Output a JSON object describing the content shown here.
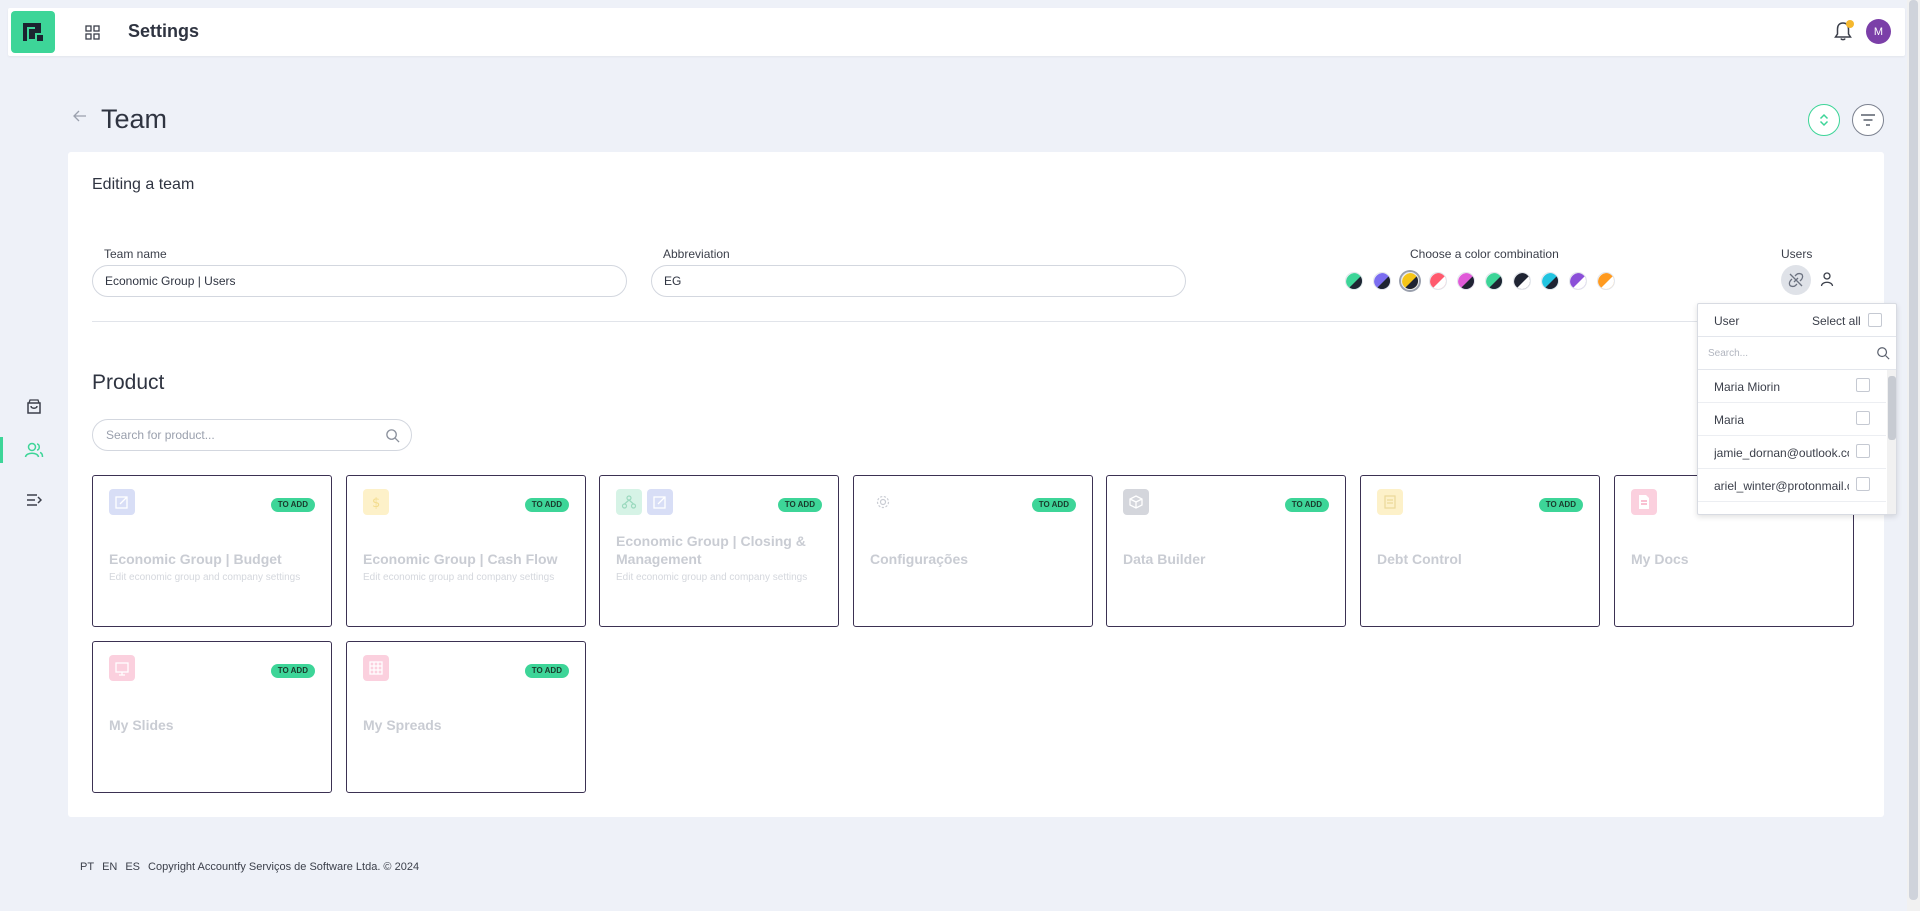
{
  "topbar": {
    "title": "Settings",
    "avatar_initial": "M"
  },
  "page": {
    "title": "Team"
  },
  "form": {
    "section_title": "Editing a team",
    "team_name_label": "Team name",
    "team_name_value": "Economic Group | Users",
    "abbreviation_label": "Abbreviation",
    "abbreviation_value": "EG",
    "color_label": "Choose a color combination",
    "users_label": "Users",
    "color_swatches": [
      {
        "c1": "#3dd598",
        "c2": "#1f2433"
      },
      {
        "c1": "#7b6df0",
        "c2": "#1f2433"
      },
      {
        "c1": "#f5c518",
        "c2": "#1f2433",
        "selected": true
      },
      {
        "c1": "#ff5a6e",
        "c2": "#ffffff"
      },
      {
        "c1": "#e05ad8",
        "c2": "#1f2433"
      },
      {
        "c1": "#3dd598",
        "c2": "#1f2433"
      },
      {
        "c1": "#1f2433",
        "c2": "#ffffff"
      },
      {
        "c1": "#22c4e0",
        "c2": "#1f2433"
      },
      {
        "c1": "#8b4fd8",
        "c2": "#ffffff"
      },
      {
        "c1": "#ff9a1f",
        "c2": "#ffffff"
      }
    ]
  },
  "product": {
    "title": "Product",
    "search_placeholder": "Search for product...",
    "tiles": [
      {
        "name": "Economic Group | Budget",
        "desc": "Edit economic group and company settings",
        "badge": "TO ADD",
        "icon": "edit-icon",
        "icon_bg": "#d8def6"
      },
      {
        "name": "Economic Group | Cash Flow",
        "desc": "Edit economic group and company settings",
        "badge": "TO ADD",
        "icon": "dollar-icon",
        "icon_bg": "#fdf1c9"
      },
      {
        "name": "Economic Group | Closing & Management",
        "desc": "Edit economic group and company settings",
        "badge": "TO ADD",
        "icon": "hierarchy-icon",
        "icon_bg": "#d6f3e6"
      },
      {
        "name": "Configurações",
        "desc": "",
        "badge": "TO ADD",
        "icon": "gear-icon",
        "icon_bg": "#ffffff"
      },
      {
        "name": "Data Builder",
        "desc": "",
        "badge": "TO ADD",
        "icon": "cube-icon",
        "icon_bg": "#d4d6dc"
      },
      {
        "name": "Debt Control",
        "desc": "",
        "badge": "TO ADD",
        "icon": "ledger-icon",
        "icon_bg": "#fdf1c9"
      },
      {
        "name": "My Docs",
        "desc": "",
        "badge": "",
        "icon": "doc-icon",
        "icon_bg": "#fbd0de"
      },
      {
        "name": "My Slides",
        "desc": "",
        "badge": "TO ADD",
        "icon": "slides-icon",
        "icon_bg": "#fbd0de"
      },
      {
        "name": "My Spreads",
        "desc": "",
        "badge": "TO ADD",
        "icon": "grid-icon",
        "icon_bg": "#fbd0de"
      }
    ]
  },
  "users_dropdown": {
    "header_user": "User",
    "select_all": "Select all",
    "search_placeholder": "Search...",
    "users": [
      {
        "name": "Maria Miorin"
      },
      {
        "name": "Maria"
      },
      {
        "name": "jamie_dornan@outlook.com"
      },
      {
        "name": "ariel_winter@protonmail.com"
      }
    ]
  },
  "footer": {
    "langs": [
      "PT",
      "EN",
      "ES"
    ],
    "copyright": "Copyright Accountfy Serviços de Software Ltda. © 2024"
  },
  "colors": {
    "accent": "#3dd598",
    "avatar": "#7b3fa8",
    "notification": "#f5b82e"
  }
}
